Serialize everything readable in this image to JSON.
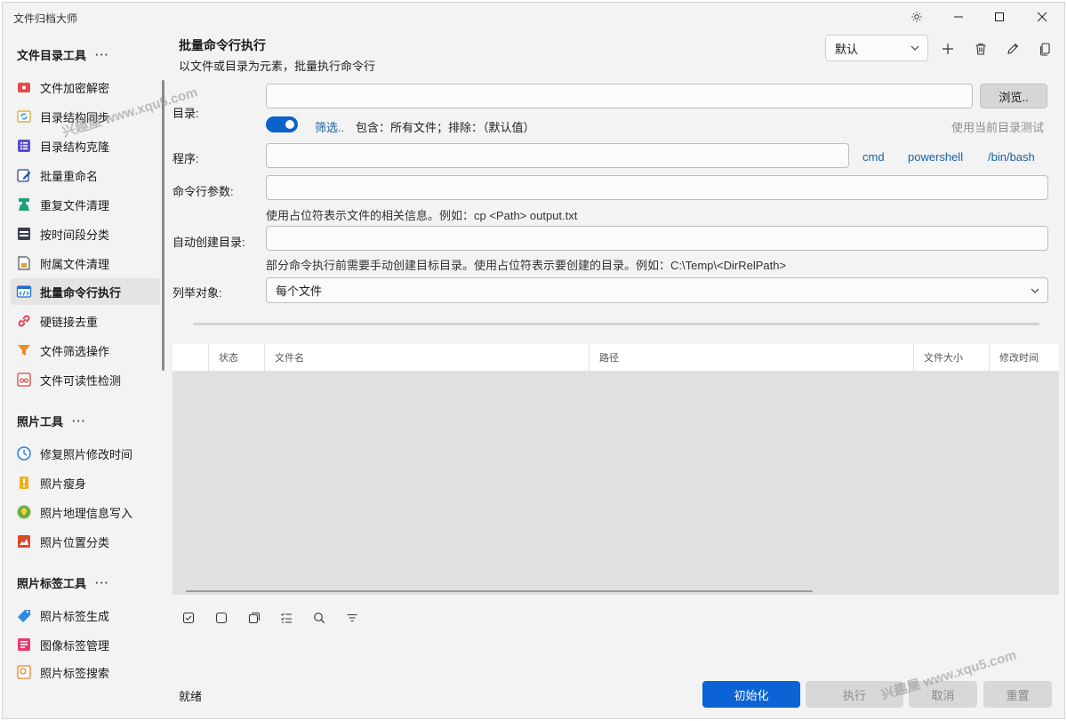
{
  "window": {
    "title": "文件归档大师"
  },
  "sidebar": {
    "groups": [
      {
        "header": "文件目录工具",
        "more": "···",
        "items": [
          {
            "label": "文件加密解密",
            "icon": "lock-file-icon"
          },
          {
            "label": "目录结构同步",
            "icon": "sync-folder-icon"
          },
          {
            "label": "目录结构克隆",
            "icon": "list-tree-icon"
          },
          {
            "label": "批量重命名",
            "icon": "rename-pen-icon"
          },
          {
            "label": "重复文件清理",
            "icon": "duplicate-clean-icon"
          },
          {
            "label": "按时间段分类",
            "icon": "calendar-sort-icon"
          },
          {
            "label": "附属文件清理",
            "icon": "attachment-file-icon"
          },
          {
            "label": "批量命令行执行",
            "icon": "terminal-icon",
            "active": true
          },
          {
            "label": "硬链接去重",
            "icon": "link-icon"
          },
          {
            "label": "文件筛选操作",
            "icon": "funnel-icon"
          },
          {
            "label": "文件可读性检测",
            "icon": "glasses-icon"
          }
        ]
      },
      {
        "header": "照片工具",
        "more": "···",
        "items": [
          {
            "label": "修复照片修改时间",
            "icon": "clock-icon"
          },
          {
            "label": "照片瘦身",
            "icon": "compress-icon"
          },
          {
            "label": "照片地理信息写入",
            "icon": "map-pin-icon"
          },
          {
            "label": "照片位置分类",
            "icon": "location-map-icon"
          }
        ]
      },
      {
        "header": "照片标签工具",
        "more": "···",
        "items": [
          {
            "label": "照片标签生成",
            "icon": "ai-tag-icon"
          },
          {
            "label": "图像标签管理",
            "icon": "tag-list-icon"
          },
          {
            "label": "照片标签搜索",
            "icon": "tag-search-icon"
          }
        ]
      }
    ]
  },
  "header": {
    "title": "批量命令行执行",
    "subtitle": "以文件或目录为元素，批量执行命令行",
    "preset_value": "默认"
  },
  "form": {
    "dir_label": "目录:",
    "dir_value": "",
    "browse_label": "浏览..",
    "filter_link": "筛选..",
    "filter_desc": "包含：所有文件；排除：（默认值）",
    "test_link": "使用当前目录测试",
    "program_label": "程序:",
    "program_value": "",
    "program_presets": [
      "cmd",
      "powershell",
      "/bin/bash"
    ],
    "args_label": "命令行参数:",
    "args_value": "",
    "args_hint": "使用占位符表示文件的相关信息。例如：cp <Path> output.txt",
    "autodir_label": "自动创建目录:",
    "autodir_value": "",
    "autodir_hint": "部分命令执行前需要手动创建目标目录。使用占位符表示要创建的目录。例如：C:\\Temp\\<DirRelPath>",
    "enum_label": "列举对象:",
    "enum_value": "每个文件"
  },
  "table": {
    "columns": [
      "",
      "状态",
      "文件名",
      "路径",
      "文件大小",
      "修改时间"
    ],
    "rows": []
  },
  "footer": {
    "status": "就绪",
    "init_label": "初始化",
    "execute_label": "执行",
    "cancel_label": "取消",
    "reset_label": "重置"
  },
  "watermarks": [
    "兴趣屋 www.xqu5.com",
    "兴趣屋 www.xqu5.com"
  ],
  "colors": {
    "accent": "#0b63d6",
    "link": "#1b5fa8"
  }
}
